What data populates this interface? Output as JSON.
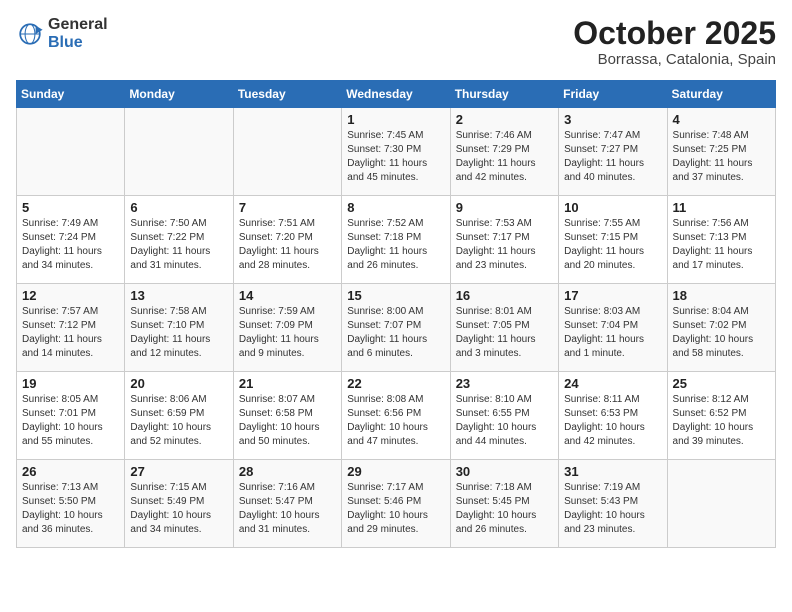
{
  "header": {
    "logo_general": "General",
    "logo_blue": "Blue",
    "month_title": "October 2025",
    "location": "Borrassa, Catalonia, Spain"
  },
  "days_of_week": [
    "Sunday",
    "Monday",
    "Tuesday",
    "Wednesday",
    "Thursday",
    "Friday",
    "Saturday"
  ],
  "weeks": [
    [
      {
        "day": "",
        "info": ""
      },
      {
        "day": "",
        "info": ""
      },
      {
        "day": "",
        "info": ""
      },
      {
        "day": "1",
        "info": "Sunrise: 7:45 AM\nSunset: 7:30 PM\nDaylight: 11 hours and 45 minutes."
      },
      {
        "day": "2",
        "info": "Sunrise: 7:46 AM\nSunset: 7:29 PM\nDaylight: 11 hours and 42 minutes."
      },
      {
        "day": "3",
        "info": "Sunrise: 7:47 AM\nSunset: 7:27 PM\nDaylight: 11 hours and 40 minutes."
      },
      {
        "day": "4",
        "info": "Sunrise: 7:48 AM\nSunset: 7:25 PM\nDaylight: 11 hours and 37 minutes."
      }
    ],
    [
      {
        "day": "5",
        "info": "Sunrise: 7:49 AM\nSunset: 7:24 PM\nDaylight: 11 hours and 34 minutes."
      },
      {
        "day": "6",
        "info": "Sunrise: 7:50 AM\nSunset: 7:22 PM\nDaylight: 11 hours and 31 minutes."
      },
      {
        "day": "7",
        "info": "Sunrise: 7:51 AM\nSunset: 7:20 PM\nDaylight: 11 hours and 28 minutes."
      },
      {
        "day": "8",
        "info": "Sunrise: 7:52 AM\nSunset: 7:18 PM\nDaylight: 11 hours and 26 minutes."
      },
      {
        "day": "9",
        "info": "Sunrise: 7:53 AM\nSunset: 7:17 PM\nDaylight: 11 hours and 23 minutes."
      },
      {
        "day": "10",
        "info": "Sunrise: 7:55 AM\nSunset: 7:15 PM\nDaylight: 11 hours and 20 minutes."
      },
      {
        "day": "11",
        "info": "Sunrise: 7:56 AM\nSunset: 7:13 PM\nDaylight: 11 hours and 17 minutes."
      }
    ],
    [
      {
        "day": "12",
        "info": "Sunrise: 7:57 AM\nSunset: 7:12 PM\nDaylight: 11 hours and 14 minutes."
      },
      {
        "day": "13",
        "info": "Sunrise: 7:58 AM\nSunset: 7:10 PM\nDaylight: 11 hours and 12 minutes."
      },
      {
        "day": "14",
        "info": "Sunrise: 7:59 AM\nSunset: 7:09 PM\nDaylight: 11 hours and 9 minutes."
      },
      {
        "day": "15",
        "info": "Sunrise: 8:00 AM\nSunset: 7:07 PM\nDaylight: 11 hours and 6 minutes."
      },
      {
        "day": "16",
        "info": "Sunrise: 8:01 AM\nSunset: 7:05 PM\nDaylight: 11 hours and 3 minutes."
      },
      {
        "day": "17",
        "info": "Sunrise: 8:03 AM\nSunset: 7:04 PM\nDaylight: 11 hours and 1 minute."
      },
      {
        "day": "18",
        "info": "Sunrise: 8:04 AM\nSunset: 7:02 PM\nDaylight: 10 hours and 58 minutes."
      }
    ],
    [
      {
        "day": "19",
        "info": "Sunrise: 8:05 AM\nSunset: 7:01 PM\nDaylight: 10 hours and 55 minutes."
      },
      {
        "day": "20",
        "info": "Sunrise: 8:06 AM\nSunset: 6:59 PM\nDaylight: 10 hours and 52 minutes."
      },
      {
        "day": "21",
        "info": "Sunrise: 8:07 AM\nSunset: 6:58 PM\nDaylight: 10 hours and 50 minutes."
      },
      {
        "day": "22",
        "info": "Sunrise: 8:08 AM\nSunset: 6:56 PM\nDaylight: 10 hours and 47 minutes."
      },
      {
        "day": "23",
        "info": "Sunrise: 8:10 AM\nSunset: 6:55 PM\nDaylight: 10 hours and 44 minutes."
      },
      {
        "day": "24",
        "info": "Sunrise: 8:11 AM\nSunset: 6:53 PM\nDaylight: 10 hours and 42 minutes."
      },
      {
        "day": "25",
        "info": "Sunrise: 8:12 AM\nSunset: 6:52 PM\nDaylight: 10 hours and 39 minutes."
      }
    ],
    [
      {
        "day": "26",
        "info": "Sunrise: 7:13 AM\nSunset: 5:50 PM\nDaylight: 10 hours and 36 minutes."
      },
      {
        "day": "27",
        "info": "Sunrise: 7:15 AM\nSunset: 5:49 PM\nDaylight: 10 hours and 34 minutes."
      },
      {
        "day": "28",
        "info": "Sunrise: 7:16 AM\nSunset: 5:47 PM\nDaylight: 10 hours and 31 minutes."
      },
      {
        "day": "29",
        "info": "Sunrise: 7:17 AM\nSunset: 5:46 PM\nDaylight: 10 hours and 29 minutes."
      },
      {
        "day": "30",
        "info": "Sunrise: 7:18 AM\nSunset: 5:45 PM\nDaylight: 10 hours and 26 minutes."
      },
      {
        "day": "31",
        "info": "Sunrise: 7:19 AM\nSunset: 5:43 PM\nDaylight: 10 hours and 23 minutes."
      },
      {
        "day": "",
        "info": ""
      }
    ]
  ]
}
